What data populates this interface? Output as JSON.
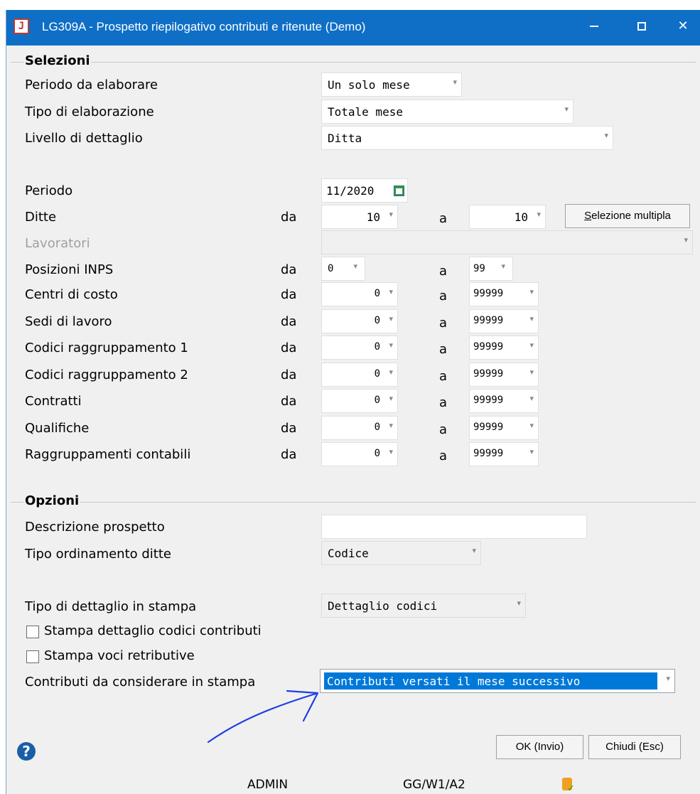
{
  "window": {
    "title": "LG309A - Prospetto riepilogativo contributi e ritenute  (Demo)",
    "icon_letter": "J"
  },
  "selezioni": {
    "title": "Selezioni",
    "periodo_da_elaborare": {
      "label": "Periodo da elaborare",
      "value": "Un solo mese"
    },
    "tipo_elaborazione": {
      "label": "Tipo di elaborazione",
      "value": "Totale mese"
    },
    "livello_dettaglio": {
      "label": "Livello di dettaglio",
      "value": "Ditta"
    },
    "periodo": {
      "label": "Periodo",
      "value": "11/2020"
    },
    "da_label": "da",
    "a_label": "a",
    "ditte": {
      "label": "Ditte",
      "from": "10",
      "to": "10"
    },
    "selezione_multipla": "Selezione multipla",
    "lavoratori": {
      "label": "Lavoratori"
    },
    "posizioni_inps": {
      "label": "Posizioni INPS",
      "from": "0",
      "to": "99"
    },
    "ranges": [
      {
        "label": "Centri di costo",
        "from": "0",
        "to": "99999"
      },
      {
        "label": "Sedi di lavoro",
        "from": "0",
        "to": "99999"
      },
      {
        "label": "Codici raggruppamento 1",
        "from": "0",
        "to": "99999"
      },
      {
        "label": "Codici raggruppamento 2",
        "from": "0",
        "to": "99999"
      },
      {
        "label": "Contratti",
        "from": "0",
        "to": "99999"
      },
      {
        "label": "Qualifiche",
        "from": "0",
        "to": "99999"
      },
      {
        "label": "Raggruppamenti contabili",
        "from": "0",
        "to": "99999"
      }
    ]
  },
  "opzioni": {
    "title": "Opzioni",
    "descrizione_prospetto": {
      "label": "Descrizione prospetto",
      "value": ""
    },
    "tipo_ordinamento": {
      "label": "Tipo ordinamento ditte",
      "value": "Codice"
    },
    "tipo_dettaglio_stampa": {
      "label": "Tipo di dettaglio in stampa",
      "value": "Dettaglio codici"
    },
    "stampa_dettaglio_codici": {
      "label": "Stampa dettaglio codici contributi",
      "checked": false
    },
    "stampa_voci": {
      "label": "Stampa voci retributive",
      "checked": false
    },
    "contributi_stampa": {
      "label": "Contributi da considerare in stampa",
      "value": "Contributi versati il mese successivo"
    }
  },
  "buttons": {
    "ok": "OK (Invio)",
    "chiudi": "Chiudi (Esc)"
  },
  "status_bar": {
    "user": "ADMIN",
    "path": "GG/W1/A2"
  },
  "colors": {
    "titlebar": "#0f6fc6",
    "selection": "#0078d7",
    "annotation_arrow": "#1f3ee6"
  }
}
